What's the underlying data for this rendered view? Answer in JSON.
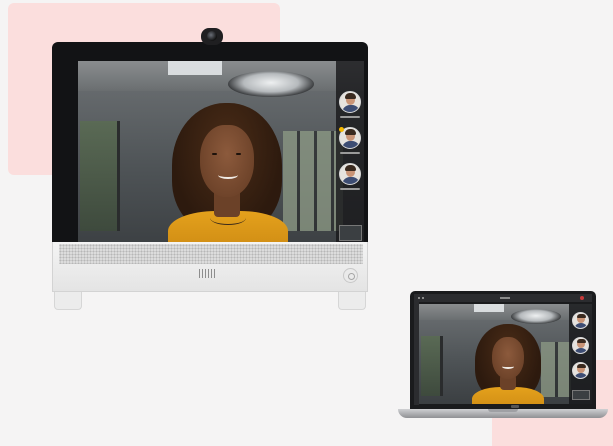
{
  "scene": {
    "background_color": "#f5f4f4",
    "accent_color": "#fbdedd"
  },
  "desk_device": {
    "screen": {
      "main_participant": "woman-smiling-yellow-sweater",
      "sidebar_participants": [
        {
          "avatar": "man-avatar",
          "speaking": false
        },
        {
          "avatar": "man-avatar",
          "speaking": true
        },
        {
          "avatar": "man-avatar",
          "speaking": false
        }
      ],
      "speaking_indicator_color": "#f5b800"
    },
    "icons": [
      "camera-icon",
      "device-logo-icon",
      "home-button-icon"
    ]
  },
  "laptop": {
    "screen": {
      "main_participant": "woman-smiling-yellow-sweater",
      "sidebar_participants": [
        {
          "avatar": "man-avatar"
        },
        {
          "avatar": "man-avatar"
        },
        {
          "avatar": "man-avatar"
        }
      ],
      "end_call_color": "#c83a3a"
    }
  }
}
